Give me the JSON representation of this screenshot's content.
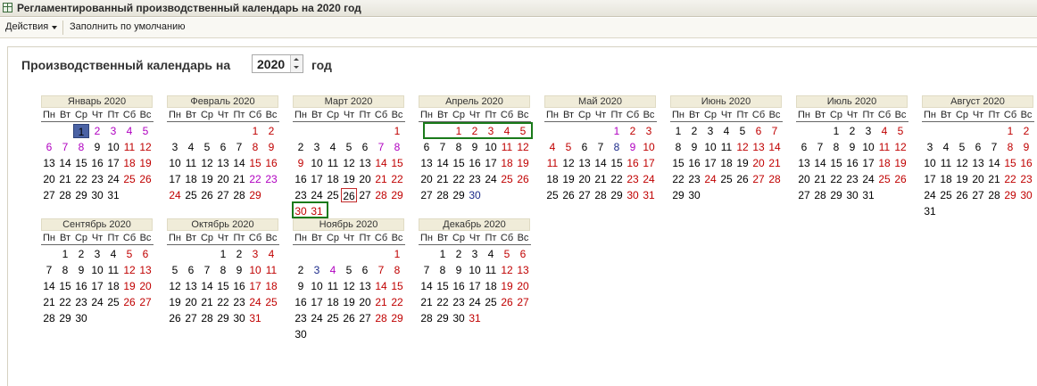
{
  "window": {
    "title": "Регламентированный производственный календарь на 2020 год"
  },
  "toolbar": {
    "actions_label": "Действия",
    "fill_default_label": "Заполнить по умолчанию"
  },
  "header": {
    "label": "Производственный календарь на",
    "year": "2020",
    "suffix": "год"
  },
  "weekday_labels": [
    "Пн",
    "Вт",
    "Ср",
    "Чт",
    "Пт",
    "Сб",
    "Вс"
  ],
  "colors": {
    "workday": "#000000",
    "holiday": "#c00000",
    "preholiday": "#b000c0",
    "selection": "#4a62a4",
    "highlight": "#1a7a1a"
  },
  "months": [
    {
      "title": "Январь 2020",
      "start": 2,
      "days": 31,
      "holiday": [
        4,
        5,
        11,
        12,
        18,
        19,
        25,
        26
      ],
      "pre": [
        2,
        3,
        4,
        5,
        6,
        7,
        8
      ],
      "sel": 1
    },
    {
      "title": "Февраль 2020",
      "start": 5,
      "days": 29,
      "holiday": [
        1,
        2,
        8,
        9,
        15,
        16,
        22,
        23,
        24,
        29
      ],
      "pre": [
        22,
        23
      ]
    },
    {
      "title": "Март 2020",
      "start": 6,
      "days": 31,
      "holiday": [
        1,
        7,
        8,
        9,
        14,
        15,
        21,
        22,
        28,
        29,
        30,
        31
      ],
      "pre": [
        7,
        8
      ],
      "today": 26
    },
    {
      "title": "Апрель 2020",
      "start": 2,
      "days": 30,
      "holiday": [
        1,
        2,
        3,
        4,
        5,
        11,
        12,
        18,
        19,
        25,
        26
      ],
      "pre": [],
      "blue": [
        30
      ]
    },
    {
      "title": "Май 2020",
      "start": 4,
      "days": 31,
      "holiday": [
        1,
        2,
        3,
        4,
        5,
        9,
        10,
        11,
        16,
        17,
        23,
        24,
        30,
        31
      ],
      "pre": [
        1,
        8,
        9
      ],
      "blue": [
        8
      ]
    },
    {
      "title": "Июнь 2020",
      "start": 0,
      "days": 30,
      "holiday": [
        6,
        7,
        12,
        13,
        14,
        20,
        21,
        24,
        27,
        28
      ],
      "pre": []
    },
    {
      "title": "Июль 2020",
      "start": 2,
      "days": 31,
      "holiday": [
        4,
        5,
        11,
        12,
        18,
        19,
        25,
        26
      ],
      "pre": []
    },
    {
      "title": "Август 2020",
      "start": 5,
      "days": 31,
      "holiday": [
        1,
        2,
        8,
        9,
        15,
        16,
        22,
        23,
        29,
        30
      ],
      "pre": []
    },
    {
      "title": "Сентябрь 2020",
      "start": 1,
      "days": 30,
      "holiday": [
        5,
        6,
        12,
        13,
        19,
        20,
        26,
        27
      ],
      "pre": []
    },
    {
      "title": "Октябрь 2020",
      "start": 3,
      "days": 31,
      "holiday": [
        3,
        4,
        10,
        11,
        17,
        18,
        24,
        25,
        31
      ],
      "pre": []
    },
    {
      "title": "Ноябрь 2020",
      "start": 6,
      "days": 30,
      "holiday": [
        1,
        4,
        7,
        8,
        14,
        15,
        21,
        22,
        28,
        29
      ],
      "pre": [
        4
      ],
      "blue": [
        3
      ]
    },
    {
      "title": "Декабрь 2020",
      "start": 1,
      "days": 31,
      "holiday": [
        5,
        6,
        12,
        13,
        19,
        20,
        26,
        27,
        31
      ],
      "pre": []
    }
  ]
}
